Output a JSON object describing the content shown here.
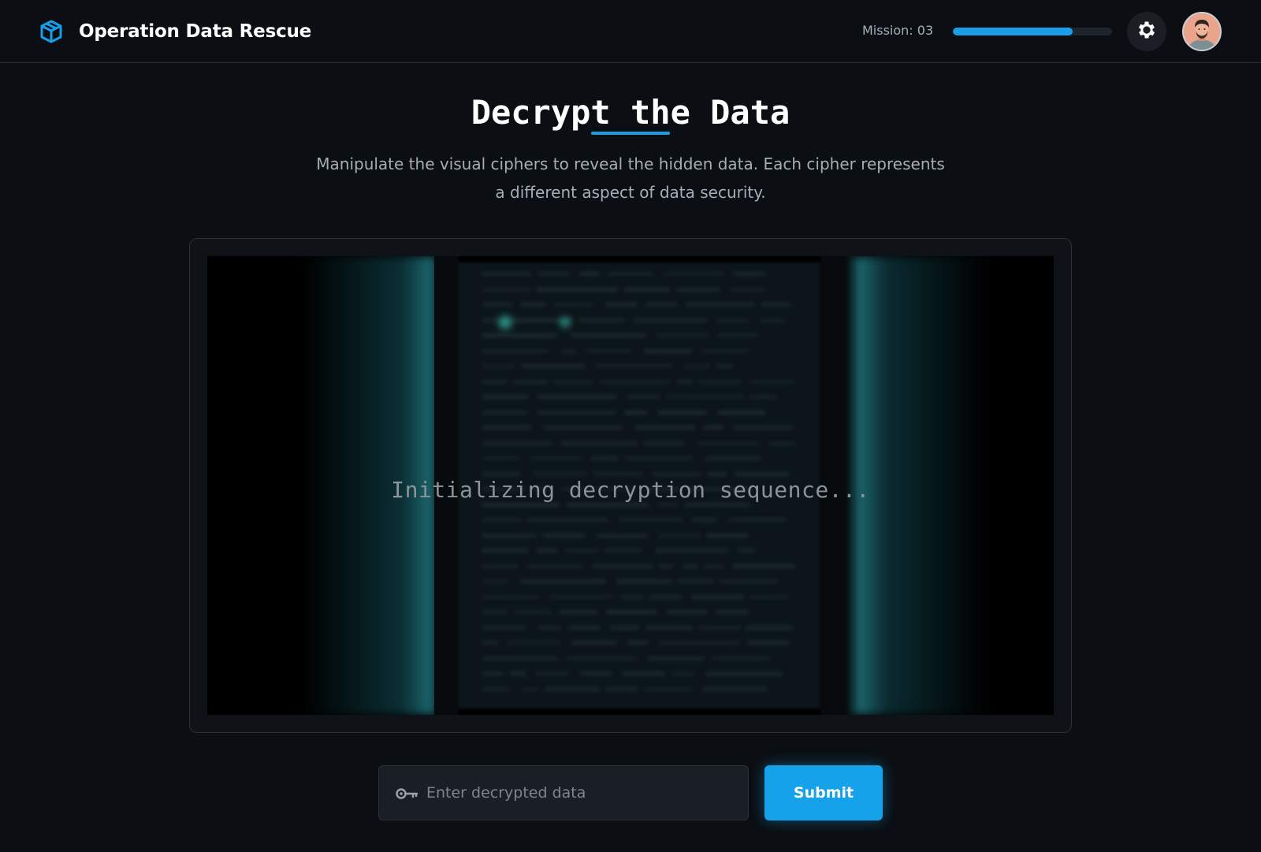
{
  "app": {
    "title": "Operation Data Rescue",
    "brand_icon": "cube-icon",
    "accent_color": "#1a9ee8"
  },
  "header": {
    "mission_label": "Mission: 03",
    "mission_progress": 0.75,
    "settings_icon": "gear-icon",
    "avatar_icon": "user-avatar"
  },
  "main": {
    "title": "Decrypt the Data",
    "subtitle": "Manipulate the visual ciphers to reveal the hidden data. Each cipher represents a different aspect of data security."
  },
  "cipher": {
    "status_text": "Initializing decryption sequence..."
  },
  "answer": {
    "placeholder": "Enter decrypted data",
    "value": "",
    "input_icon": "key-icon",
    "submit_label": "Submit"
  }
}
